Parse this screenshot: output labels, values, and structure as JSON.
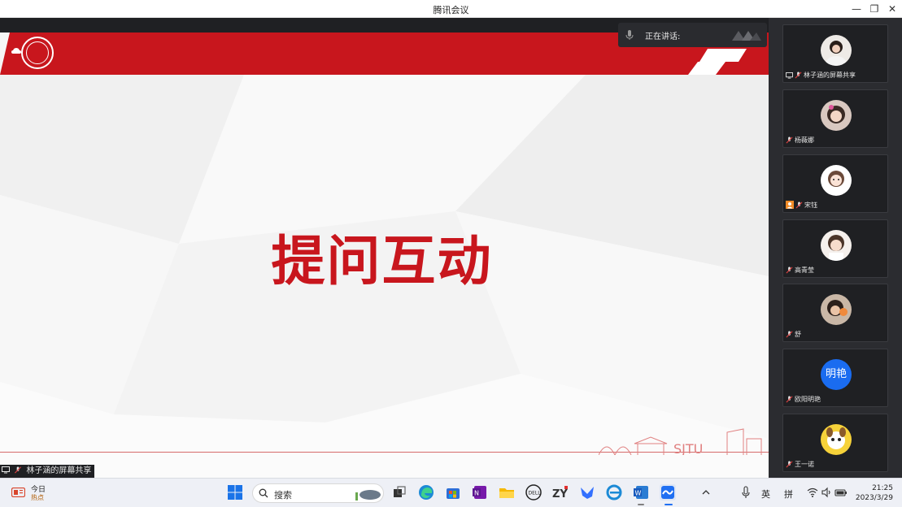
{
  "window": {
    "title": "腾讯会议",
    "minimize": "—",
    "restore": "❐",
    "close": "✕"
  },
  "speaking": {
    "label": "正在讲话:"
  },
  "slide": {
    "title": "提问互动",
    "watermark": "SJTU"
  },
  "share_label": "林子涵的屏幕共享",
  "participants": [
    {
      "name": "林子涵的屏幕共享",
      "avatar": "photo"
    },
    {
      "name": "杨薇娜",
      "avatar": "photo"
    },
    {
      "name": "宋钰",
      "avatar": "photo"
    },
    {
      "name": "高青莹",
      "avatar": "photo"
    },
    {
      "name": "舒",
      "avatar": "photo"
    },
    {
      "name": "欧阳明艳",
      "avatar": "text",
      "avatar_text": "明艳"
    },
    {
      "name": "王一诺",
      "avatar": "photo"
    }
  ],
  "taskbar": {
    "news_line1": "今日",
    "news_line2": "热点",
    "search_placeholder": "搜索",
    "ime_lang": "英",
    "ime_mode": "拼",
    "time": "21:25",
    "date": "2023/3/29"
  },
  "colors": {
    "brand_red": "#c8161d",
    "tile_bg": "#1f2023",
    "sidebar_bg": "#2b2c30"
  }
}
